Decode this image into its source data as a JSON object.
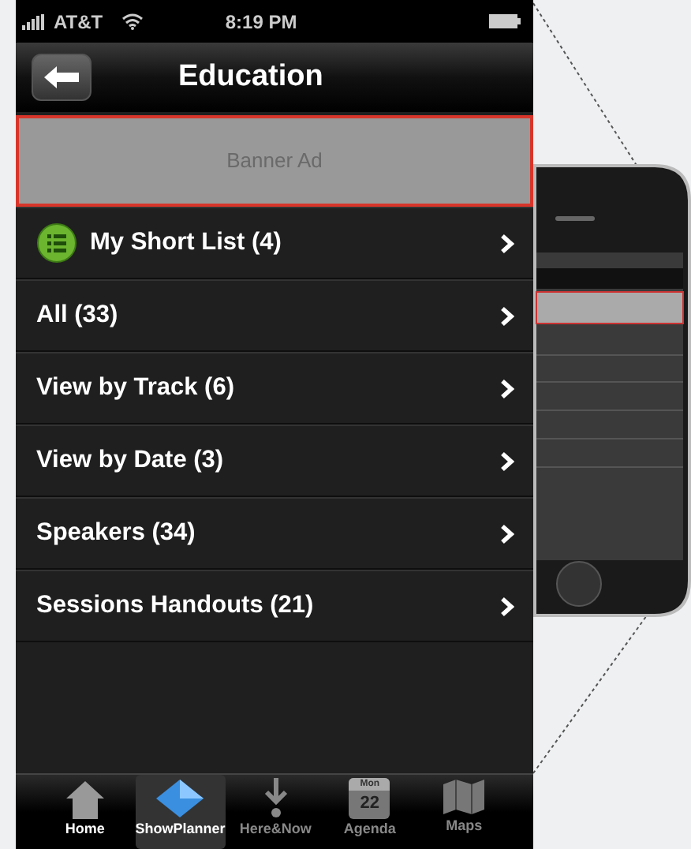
{
  "status_bar": {
    "carrier": "AT&T",
    "time": "8:19 PM"
  },
  "nav_bar": {
    "title": "Education"
  },
  "banner": {
    "text": "Banner Ad"
  },
  "menu_items": [
    {
      "label": "My Short List (4)",
      "kind": "with-icon"
    },
    {
      "label": "All (33)",
      "kind": "plain"
    },
    {
      "label": "View by Track (6)",
      "kind": "plain"
    },
    {
      "label": "View by Date (3)",
      "kind": "plain"
    },
    {
      "label": "Speakers (34)",
      "kind": "plain"
    },
    {
      "label": "Sessions Handouts (21)",
      "kind": "plain"
    }
  ],
  "tabs": [
    {
      "label": "Home",
      "kind": "home",
      "selected": false
    },
    {
      "label": "ShowPlanner",
      "kind": "planner",
      "selected": true
    },
    {
      "label": "Here&Now",
      "kind": "arrow",
      "selected": false
    },
    {
      "label": "Agenda",
      "kind": "calendar",
      "selected": false,
      "month": "Mon",
      "day": "22"
    },
    {
      "label": "Maps",
      "kind": "map",
      "selected": false
    }
  ]
}
